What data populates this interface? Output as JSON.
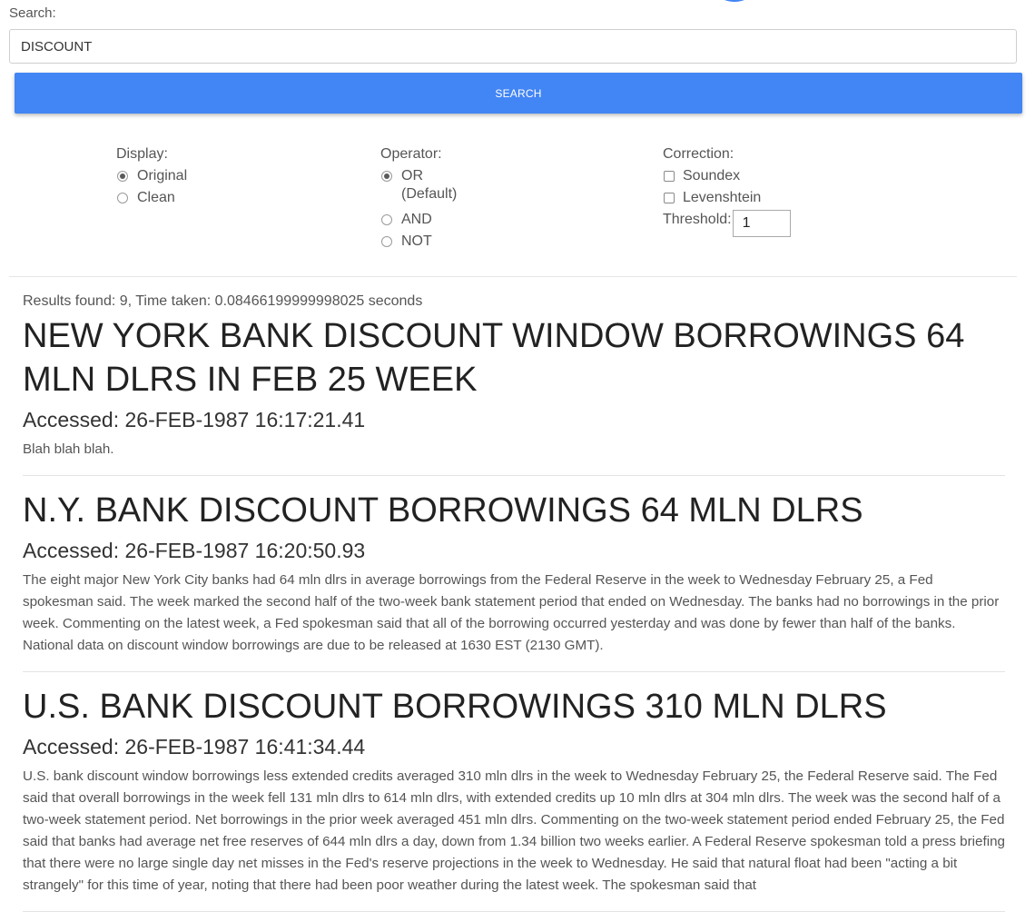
{
  "search": {
    "label": "Search:",
    "value": "DISCOUNT",
    "button_label": "SEARCH"
  },
  "display": {
    "title": "Display:",
    "options": [
      "Original",
      "Clean"
    ],
    "selected": "Original"
  },
  "operator": {
    "title": "Operator:",
    "options": [
      "OR\n(Default)",
      "AND",
      "NOT"
    ],
    "selected": "OR"
  },
  "correction": {
    "title": "Correction:",
    "options": [
      "Soundex",
      "Levenshtein"
    ],
    "threshold_label": "Threshold:",
    "threshold_value": "1"
  },
  "results": {
    "summary": "Results found: 9, Time taken: 0.08466199999998025 seconds",
    "items": [
      {
        "title": "NEW YORK BANK DISCOUNT WINDOW BORROWINGS 64 MLN DLRS IN FEB 25 WEEK",
        "accessed": "Accessed: 26-FEB-1987 16:17:21.41",
        "body": "Blah blah blah."
      },
      {
        "title": "N.Y. BANK DISCOUNT BORROWINGS 64 MLN DLRS",
        "accessed": "Accessed: 26-FEB-1987 16:20:50.93",
        "body": "The eight major New York City banks had 64 mln dlrs in average borrowings from the Federal Reserve in the week to Wednesday February 25, a Fed spokesman said. The week marked the second half of the two-week bank statement period that ended on Wednesday. The banks had no borrowings in the prior week. Commenting on the latest week, a Fed spokesman said that all of the borrowing occurred yesterday and was done by fewer than half of the banks. National data on discount window borrowings are due to be released at 1630 EST (2130 GMT)."
      },
      {
        "title": "U.S. BANK DISCOUNT BORROWINGS 310 MLN DLRS",
        "accessed": "Accessed: 26-FEB-1987 16:41:34.44",
        "body": "U.S. bank discount window borrowings less extended credits averaged 310 mln dlrs in the week to Wednesday February 25, the Federal Reserve said. The Fed said that overall borrowings in the week fell 131 mln dlrs to 614 mln dlrs, with extended credits up 10 mln dlrs at 304 mln dlrs. The week was the second half of a two-week statement period. Net borrowings in the prior week averaged 451 mln dlrs. Commenting on the two-week statement period ended February 25, the Fed said that banks had average net free reserves of 644 mln dlrs a day, down from 1.34 billion two weeks earlier. A Federal Reserve spokesman told a press briefing that there were no large single day net misses in the Fed's reserve projections in the week to Wednesday. He said that natural float had been \"acting a bit strangely\" for this time of year, noting that there had been poor weather during the latest week. The spokesman said that"
      }
    ]
  }
}
